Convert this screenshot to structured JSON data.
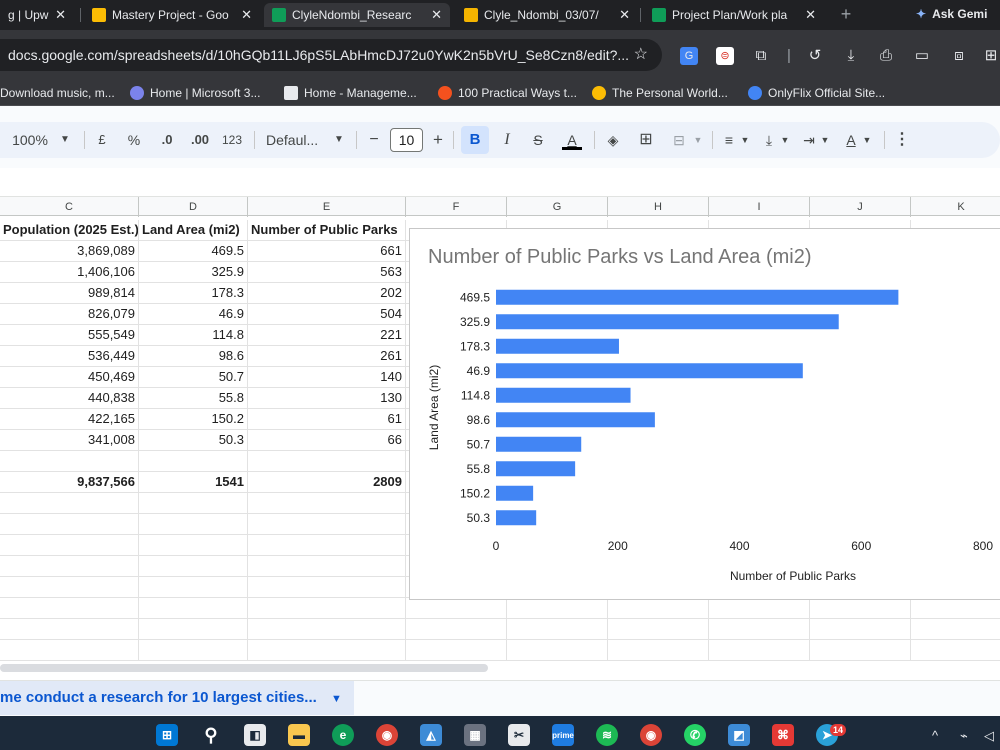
{
  "browser": {
    "tabs": [
      {
        "title": "g | Upw",
        "icon_color": "#6fda44"
      },
      {
        "title": "Mastery Project - Goo",
        "icon_color": "#fbbc04"
      },
      {
        "title": "ClyleNdombi_Researc",
        "icon_color": "#0f9d58",
        "active": true
      },
      {
        "title": "Clyle_Ndombi_03/07/",
        "icon_color": "#f4b400"
      },
      {
        "title": "Project Plan/Work pla",
        "icon_color": "#0f9d58"
      }
    ],
    "new_tab": "+",
    "ask_gemini": "Ask Gemi",
    "url": "docs.google.com/spreadsheets/d/10hGQb11LJ6pS5LAbHmcDJ72u0YwK2n5bVrU_Se8Czn8/edit?...",
    "bookmarks": [
      {
        "label": "Download music, m...",
        "icon_color": "#9aa0a6"
      },
      {
        "label": "Home | Microsoft 3...",
        "icon_color": "#7b83eb"
      },
      {
        "label": "Home - Manageme...",
        "icon_color": "#e8eaed"
      },
      {
        "label": "100 Practical Ways t...",
        "icon_color": "#f4511e"
      },
      {
        "label": "The Personal World...",
        "icon_color": "#fbbc04"
      },
      {
        "label": "OnlyFlix Official Site...",
        "icon_color": "#4285f4"
      }
    ]
  },
  "sheets_toolbar": {
    "zoom": "100%",
    "currency": "£",
    "percent": "%",
    "dec_decrease": ".0",
    "dec_increase": ".00",
    "number_format": "123",
    "font": "Defaul...",
    "font_size": "10",
    "minus": "−",
    "plus": "+",
    "bold": "B",
    "italic": "I",
    "strike": "S",
    "text_color": "A",
    "more": "⋮"
  },
  "grid": {
    "columns": [
      "C",
      "D",
      "E",
      "F",
      "G",
      "H",
      "I",
      "J",
      "K"
    ],
    "headers": [
      "Population (2025 Est.)",
      "Land Area (mi2)",
      "Number of Public Parks"
    ],
    "rows": [
      [
        "3,869,089",
        "469.5",
        "661"
      ],
      [
        "1,406,106",
        "325.9",
        "563"
      ],
      [
        "989,814",
        "178.3",
        "202"
      ],
      [
        "826,079",
        "46.9",
        "504"
      ],
      [
        "555,549",
        "114.8",
        "221"
      ],
      [
        "536,449",
        "98.6",
        "261"
      ],
      [
        "450,469",
        "50.7",
        "140"
      ],
      [
        "440,838",
        "55.8",
        "130"
      ],
      [
        "422,165",
        "150.2",
        "61"
      ],
      [
        "341,008",
        "50.3",
        "66"
      ]
    ],
    "totals": [
      "9,837,566",
      "1541",
      "2809"
    ]
  },
  "chart_data": {
    "type": "bar",
    "orientation": "horizontal",
    "title": "Number of Public Parks vs Land Area (mi2)",
    "xlabel": "Number of Public Parks",
    "ylabel": "Land Area (mi2)",
    "categories": [
      "469.5",
      "325.9",
      "178.3",
      "46.9",
      "114.8",
      "98.6",
      "50.7",
      "55.8",
      "150.2",
      "50.3"
    ],
    "values": [
      661,
      563,
      202,
      504,
      221,
      261,
      140,
      130,
      61,
      66
    ],
    "xticks": [
      "0",
      "200",
      "400",
      "600",
      "800"
    ],
    "xlim": [
      0,
      800
    ],
    "bar_color": "#4285f4",
    "grid": false,
    "legend": "none"
  },
  "sheet_tab": {
    "label": "me conduct a research for 10 largest cities...",
    "caret": "▼"
  },
  "taskbar": {
    "chrome_badge": "14"
  }
}
